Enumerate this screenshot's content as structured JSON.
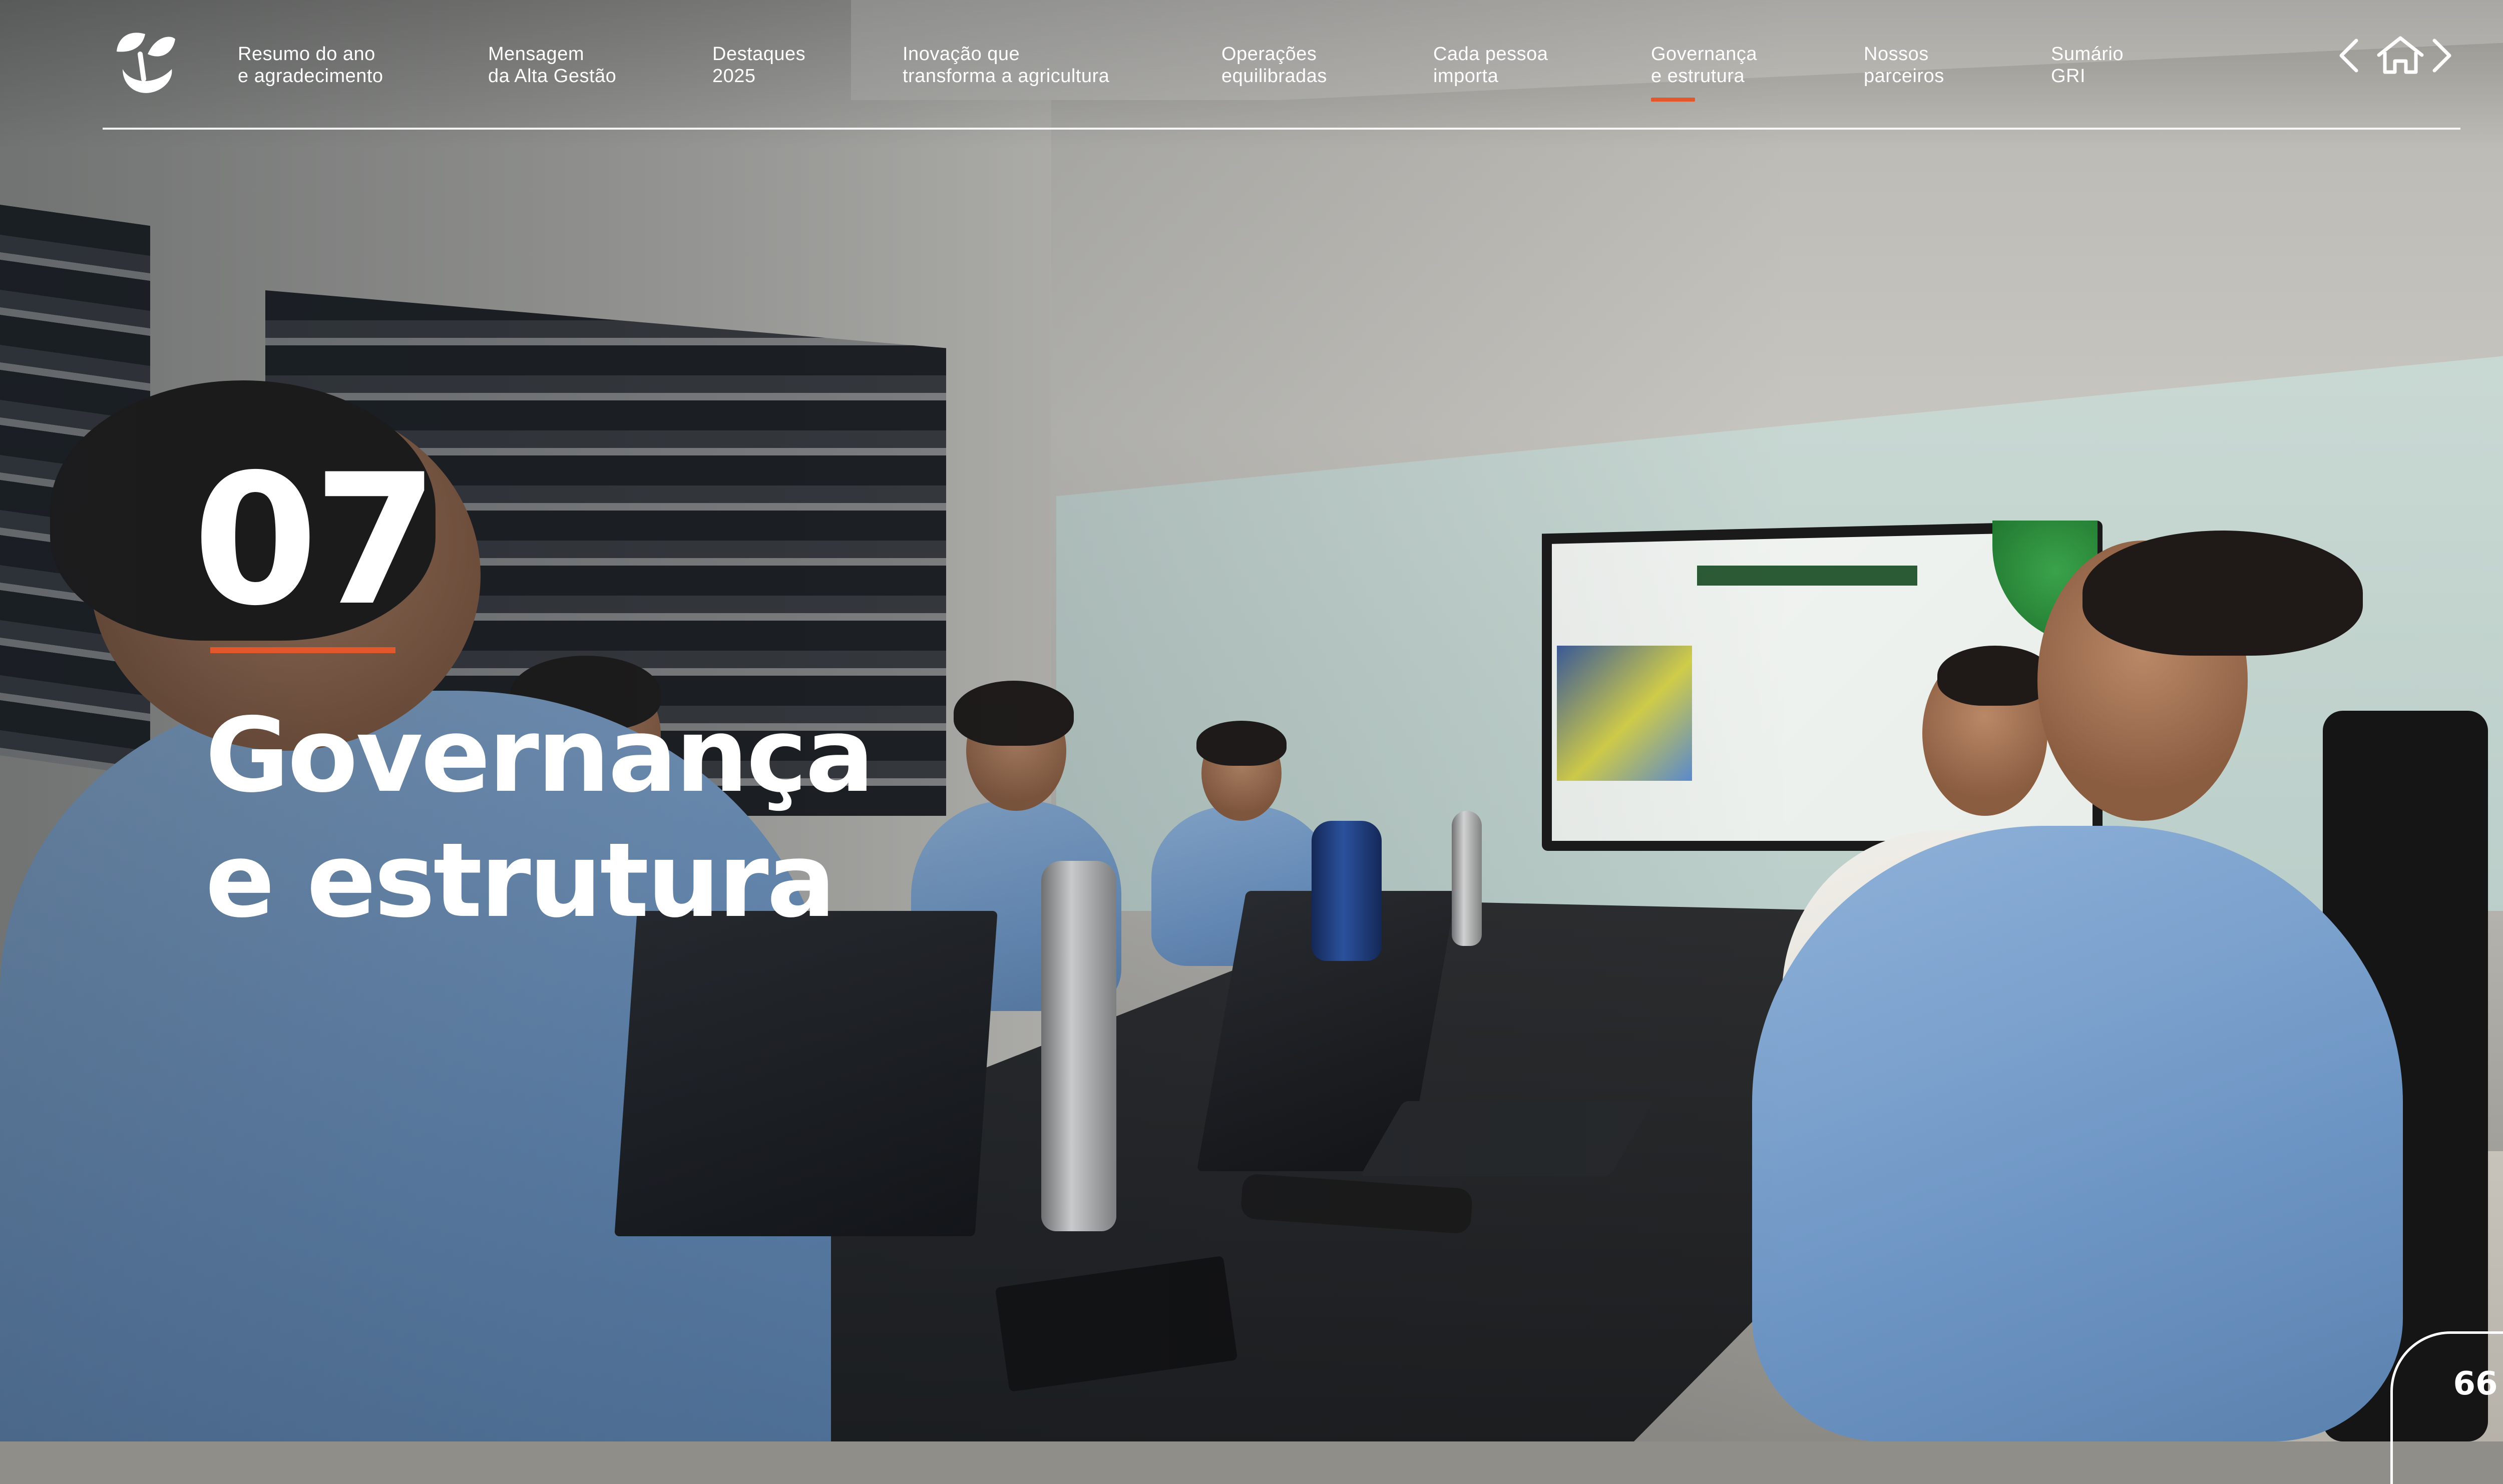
{
  "nav": {
    "items": [
      {
        "label": "Resumo do ano\ne agradecimento"
      },
      {
        "label": "Mensagem\nda Alta Gestão"
      },
      {
        "label": "Destaques\n2025"
      },
      {
        "label": "Inovação que\ntransforma a agricultura"
      },
      {
        "label": "Operações\nequilibradas"
      },
      {
        "label": "Cada pessoa\nimporta"
      },
      {
        "label": "Governança\ne estrutura"
      },
      {
        "label": "Nossos\nparceiros"
      },
      {
        "label": "Sumário\nGRI"
      }
    ],
    "active_index": 6,
    "prev_icon": "chevron-left-icon",
    "home_icon": "home-icon",
    "next_icon": "chevron-right-icon"
  },
  "chapter": {
    "number": "07",
    "title": "Governança\ne estrutura"
  },
  "page": {
    "number": "66"
  },
  "colors": {
    "accent": "#e2572b",
    "text": "#ffffff"
  }
}
